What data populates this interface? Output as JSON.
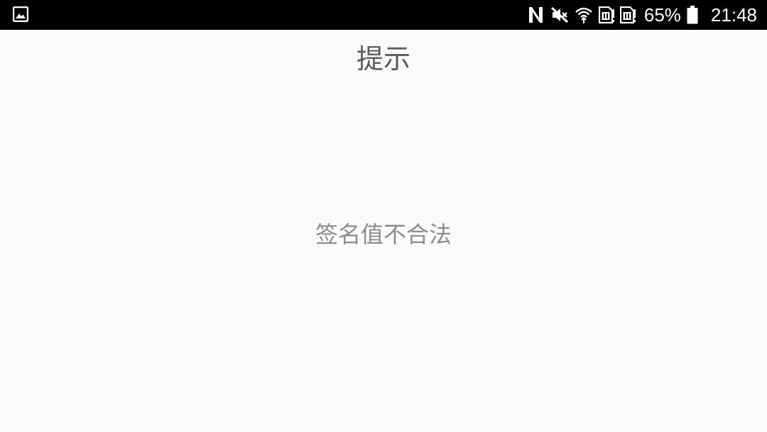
{
  "status_bar": {
    "battery_percent": "65%",
    "time": "21:48",
    "icons": [
      "image-icon",
      "nfc-icon",
      "mute-icon",
      "wifi-icon",
      "sim1-icon",
      "sim2-icon",
      "battery-icon"
    ]
  },
  "dialog": {
    "title": "提示",
    "message": "签名值不合法"
  },
  "colors": {
    "status_bar_bg": "#000000",
    "background": "#fafafa",
    "title_text": "#5a5a5a",
    "message_text": "#8c8c8c"
  }
}
